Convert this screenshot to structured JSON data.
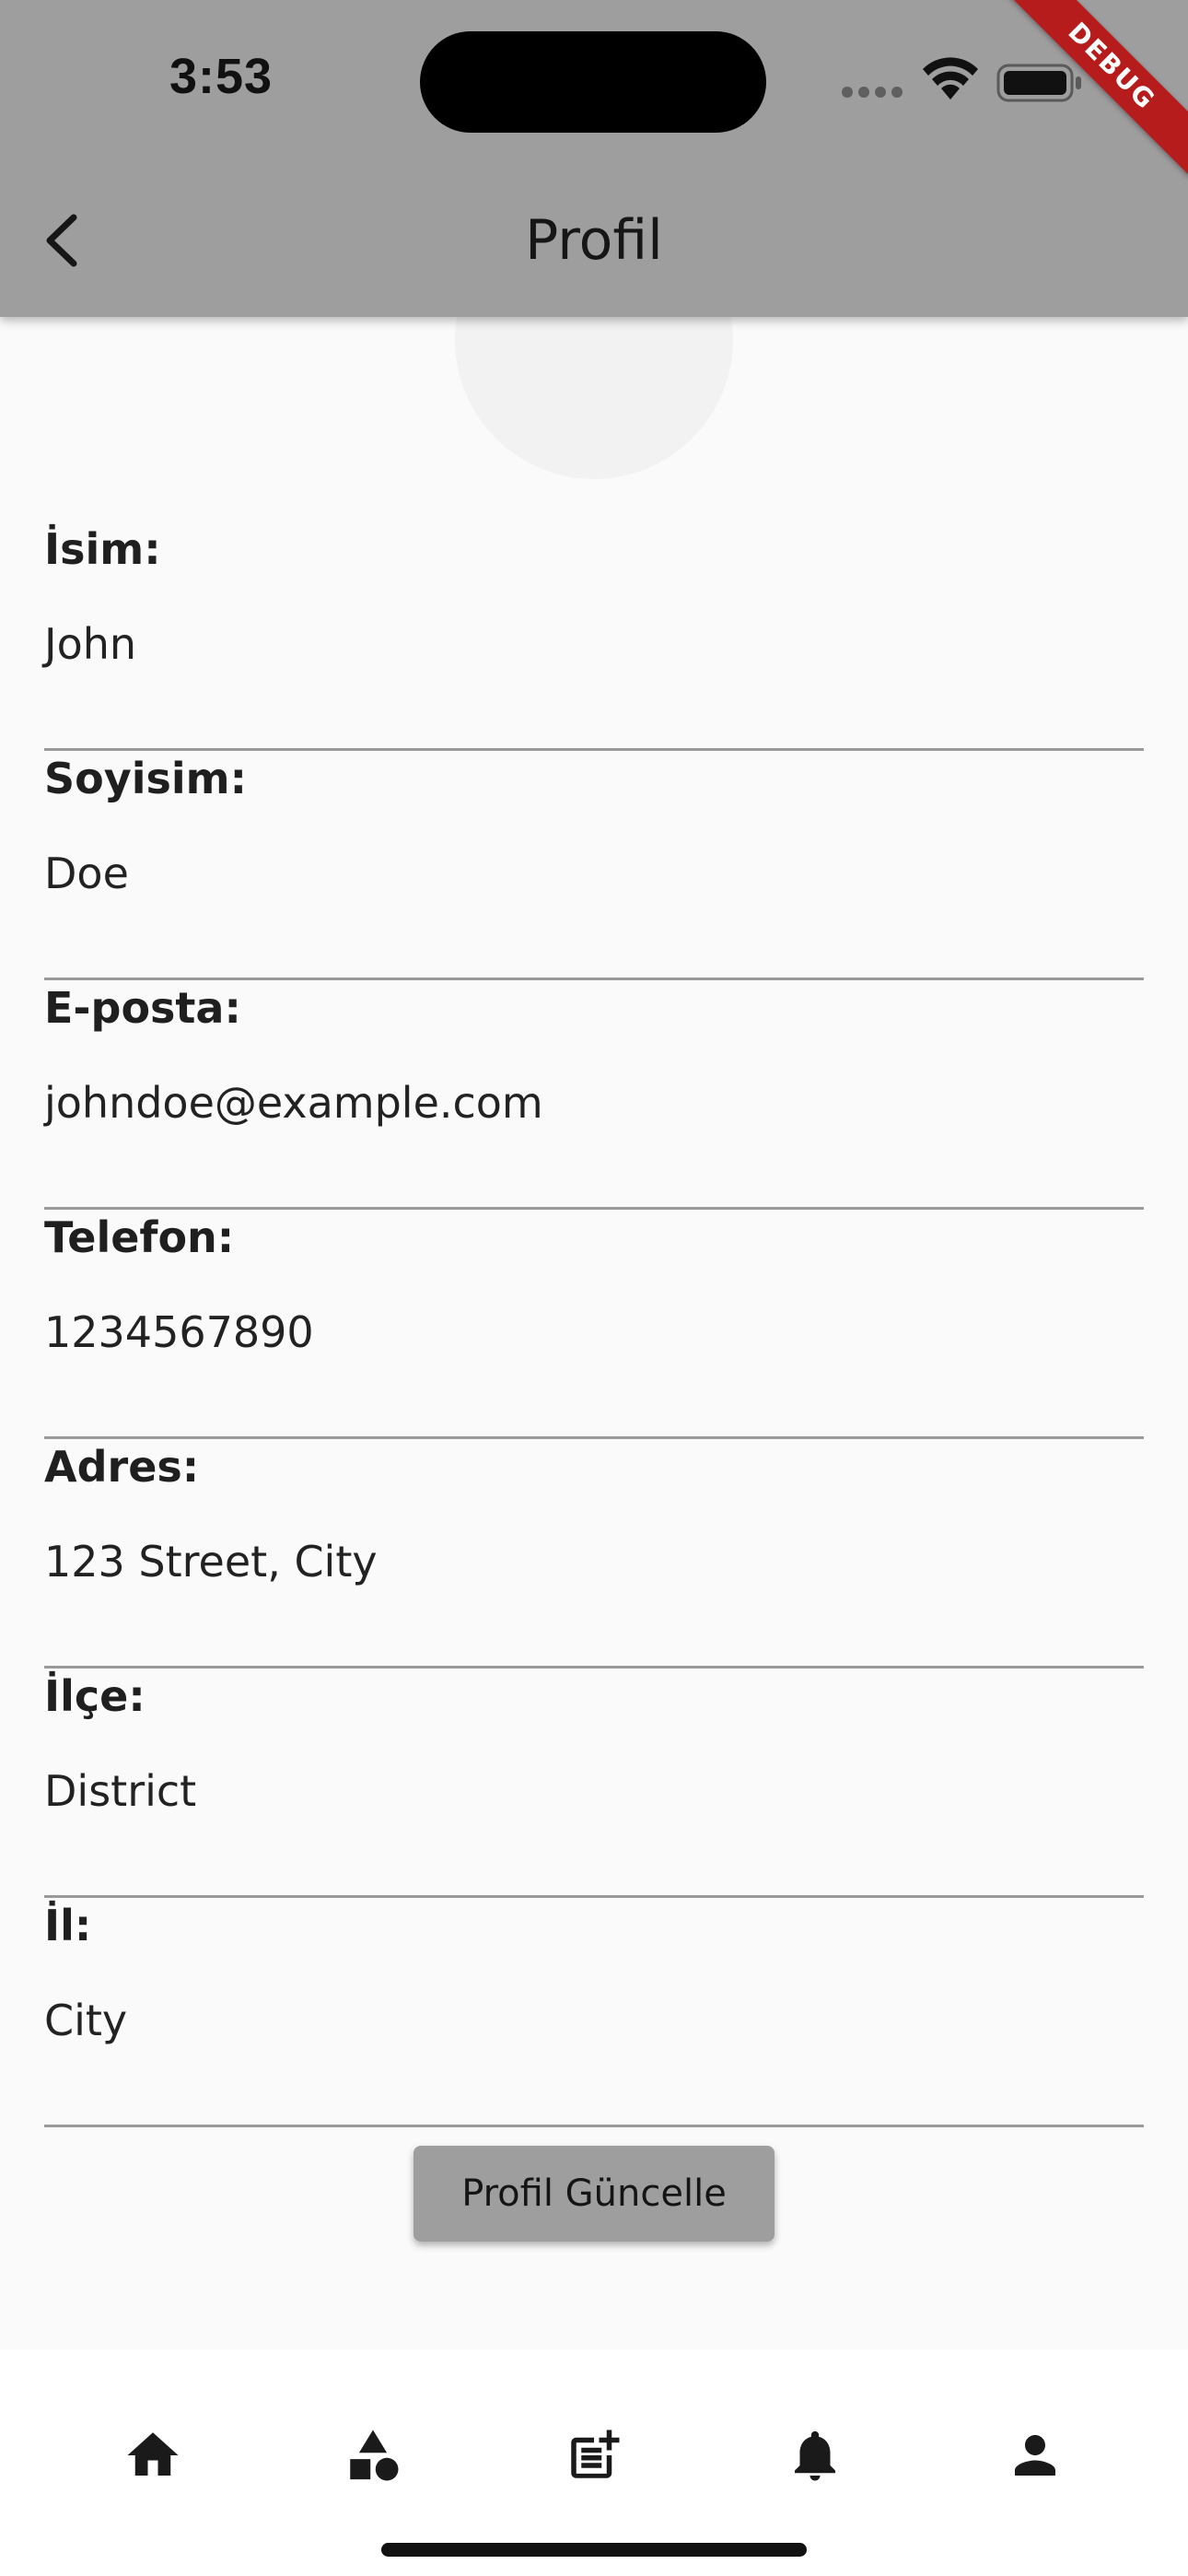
{
  "status_bar": {
    "time": "3:53",
    "debug_label": "DEBUG"
  },
  "app_bar": {
    "title": "Profil",
    "back_icon": "chevron-left-icon"
  },
  "profile_fields": [
    {
      "label": "İsim:",
      "value": "John"
    },
    {
      "label": "Soyisim:",
      "value": "Doe"
    },
    {
      "label": "E-posta:",
      "value": "johndoe@example.com"
    },
    {
      "label": "Telefon:",
      "value": "1234567890"
    },
    {
      "label": "Adres:",
      "value": "123 Street, City"
    },
    {
      "label": "İlçe:",
      "value": "District"
    },
    {
      "label": "İl:",
      "value": "City"
    }
  ],
  "update_button": {
    "label": "Profil Güncelle"
  },
  "bottom_nav": {
    "items": [
      {
        "icon": "home-icon"
      },
      {
        "icon": "category-icon"
      },
      {
        "icon": "post-add-icon"
      },
      {
        "icon": "notifications-icon"
      },
      {
        "icon": "person-icon"
      }
    ]
  },
  "colors": {
    "app_bar": "#9e9e9e",
    "background": "#fafafa",
    "button": "#9e9e9e",
    "divider": "#9a9a9a",
    "debug_ribbon": "#b71c1c"
  }
}
